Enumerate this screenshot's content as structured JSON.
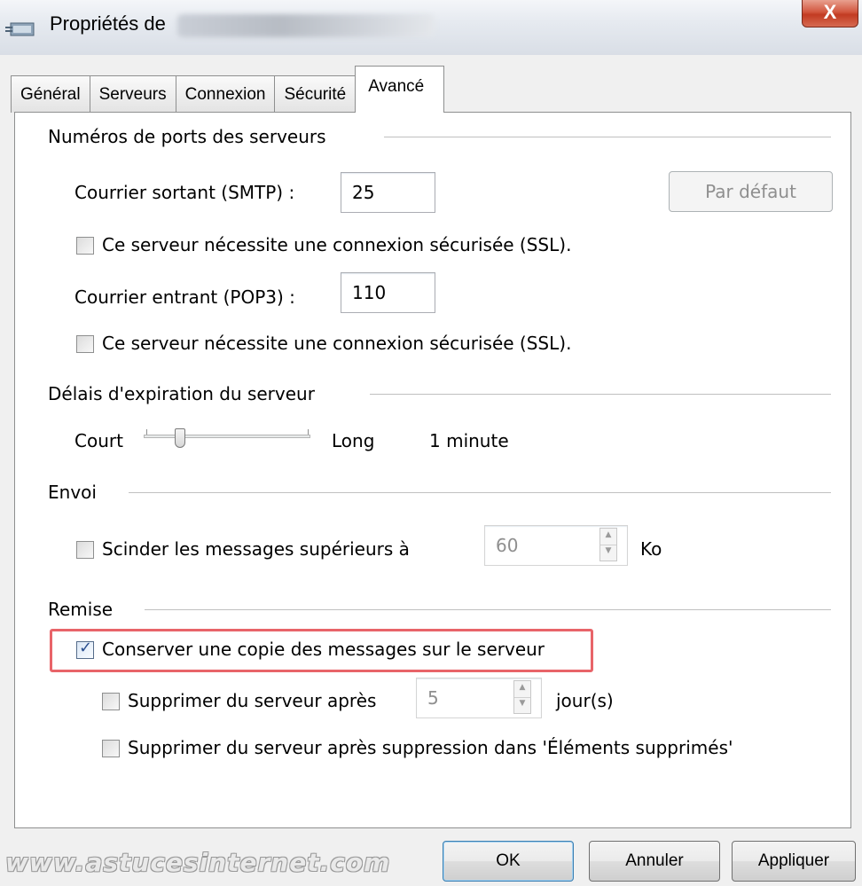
{
  "window": {
    "title": "Propriétés de",
    "close_label": "X",
    "icon": "mail-account-icon"
  },
  "tabs": [
    {
      "label": "Général",
      "active": false
    },
    {
      "label": "Serveurs",
      "active": false
    },
    {
      "label": "Connexion",
      "active": false
    },
    {
      "label": "Sécurité",
      "active": false
    },
    {
      "label": "Avancé",
      "active": true
    }
  ],
  "ports": {
    "group_title": "Numéros de ports des serveurs",
    "smtp_label": "Courrier sortant (SMTP) :",
    "smtp_value": "25",
    "default_button": "Par défaut",
    "smtp_ssl_label": "Ce serveur nécessite une connexion sécurisée (SSL).",
    "smtp_ssl_checked": false,
    "pop3_label": "Courrier entrant (POP3) :",
    "pop3_value": "110",
    "pop3_ssl_label": "Ce serveur nécessite une connexion sécurisée (SSL).",
    "pop3_ssl_checked": false
  },
  "timeout": {
    "group_title": "Délais d'expiration du serveur",
    "short_label": "Court",
    "long_label": "Long",
    "value_text": "1 minute",
    "slider_level": 0.2
  },
  "send": {
    "group_title": "Envoi",
    "split_label": "Scinder les messages supérieurs à",
    "split_checked": false,
    "split_value": "60",
    "split_unit": "Ko"
  },
  "delivery": {
    "group_title": "Remise",
    "keep_copy_label": "Conserver une copie des messages sur le serveur",
    "keep_copy_checked": true,
    "delete_after_label": "Supprimer du serveur après",
    "delete_after_checked": false,
    "delete_after_value": "5",
    "delete_after_unit": "jour(s)",
    "delete_on_remove_label": "Supprimer du serveur après suppression dans 'Éléments supprimés'",
    "delete_on_remove_checked": false,
    "highlight_color": "#e86469"
  },
  "footer": {
    "ok": "OK",
    "cancel": "Annuler",
    "apply": "Appliquer"
  },
  "watermark": "www.astucesinternet.com"
}
